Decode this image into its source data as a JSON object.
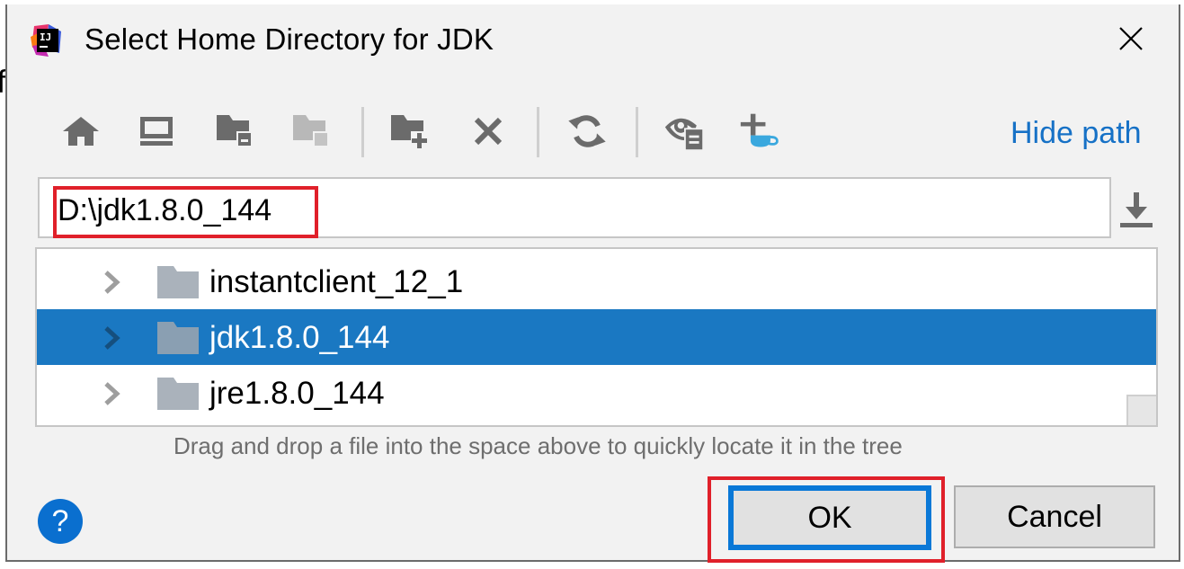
{
  "dialog": {
    "title": "Select Home Directory for JDK",
    "app_icon": "intellij-idea-logo",
    "close_icon": "close-icon"
  },
  "toolbar": {
    "buttons": [
      {
        "name": "home",
        "icon": "home-icon",
        "enabled": true
      },
      {
        "name": "desktop",
        "icon": "desktop-icon",
        "enabled": true
      },
      {
        "name": "project-directory",
        "icon": "project-folder-icon",
        "enabled": true
      },
      {
        "name": "module-directory",
        "icon": "module-folder-icon",
        "enabled": false
      },
      {
        "name": "new-folder",
        "icon": "new-folder-icon",
        "enabled": true
      },
      {
        "name": "delete",
        "icon": "delete-icon",
        "enabled": true
      },
      {
        "name": "refresh",
        "icon": "refresh-icon",
        "enabled": true
      },
      {
        "name": "show-hidden-files",
        "icon": "show-hidden-icon",
        "enabled": true
      },
      {
        "name": "download-jdk",
        "icon": "add-jdk-icon",
        "enabled": true
      }
    ],
    "hide_path_label": "Hide path"
  },
  "path": {
    "value": "D:\\jdk1.8.0_144",
    "download_icon": "download-icon"
  },
  "tree": {
    "items": [
      {
        "label": "instantclient_12_1",
        "selected": false
      },
      {
        "label": "jdk1.8.0_144",
        "selected": true
      },
      {
        "label": "jre1.8.0_144",
        "selected": false
      }
    ]
  },
  "hint": "Drag and drop a file into the space above to quickly locate it in the tree",
  "footer": {
    "help_label": "?",
    "ok_label": "OK",
    "cancel_label": "Cancel"
  },
  "colors": {
    "accent": "#1a78c2",
    "link": "#1671c6",
    "highlight_annotation": "#e0202a",
    "focus_border": "#0a78d7"
  },
  "background": {
    "left_letter": "f"
  }
}
